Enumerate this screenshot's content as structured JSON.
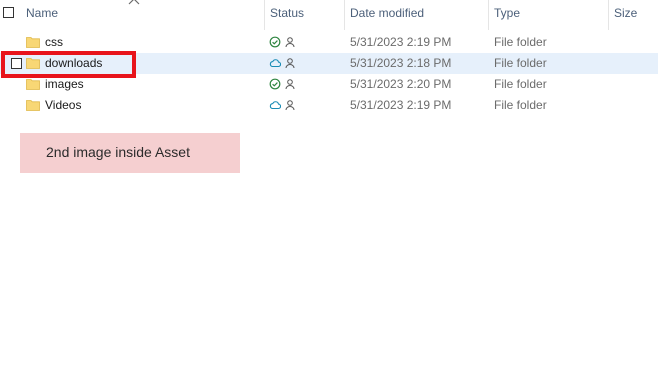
{
  "columns": {
    "name": "Name",
    "status": "Status",
    "date_modified": "Date modified",
    "type": "Type",
    "size": "Size"
  },
  "rows": [
    {
      "name": "css",
      "status": "available-locally",
      "date": "5/31/2023 2:19 PM",
      "type": "File folder",
      "selected": false
    },
    {
      "name": "downloads",
      "status": "cloud-only",
      "date": "5/31/2023 2:18 PM",
      "type": "File folder",
      "selected": true
    },
    {
      "name": "images",
      "status": "available-locally",
      "date": "5/31/2023 2:20 PM",
      "type": "File folder",
      "selected": false
    },
    {
      "name": "Videos",
      "status": "cloud-only",
      "date": "5/31/2023 2:19 PM",
      "type": "File folder",
      "selected": false
    }
  ],
  "icons": {
    "folder": "folder-icon",
    "available": "check-circle-icon",
    "cloud": "cloud-icon",
    "shared": "person-icon"
  },
  "colors": {
    "folder": "#f8d775",
    "folder_dark": "#e0b94a",
    "check": "#2e8540",
    "cloud": "#1a8cb5",
    "person": "#555555",
    "selection": "#e6f0fb",
    "highlight": "#e8141b",
    "note_bg": "#f5cfd0"
  },
  "annotation": {
    "note_text": "2nd image inside Asset"
  }
}
